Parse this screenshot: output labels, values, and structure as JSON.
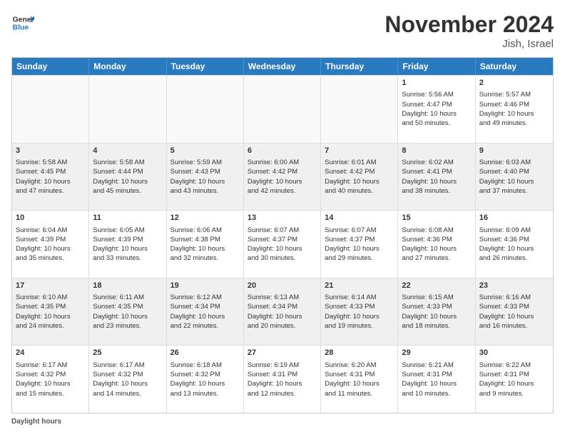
{
  "header": {
    "logo_general": "General",
    "logo_blue": "Blue",
    "title": "November 2024",
    "location": "Jish, Israel"
  },
  "weekdays": [
    "Sunday",
    "Monday",
    "Tuesday",
    "Wednesday",
    "Thursday",
    "Friday",
    "Saturday"
  ],
  "footer_label": "Daylight hours",
  "rows": [
    [
      {
        "day": "",
        "info": ""
      },
      {
        "day": "",
        "info": ""
      },
      {
        "day": "",
        "info": ""
      },
      {
        "day": "",
        "info": ""
      },
      {
        "day": "",
        "info": ""
      },
      {
        "day": "1",
        "info": "Sunrise: 5:56 AM\nSunset: 4:47 PM\nDaylight: 10 hours\nand 50 minutes."
      },
      {
        "day": "2",
        "info": "Sunrise: 5:57 AM\nSunset: 4:46 PM\nDaylight: 10 hours\nand 49 minutes."
      }
    ],
    [
      {
        "day": "3",
        "info": "Sunrise: 5:58 AM\nSunset: 4:45 PM\nDaylight: 10 hours\nand 47 minutes."
      },
      {
        "day": "4",
        "info": "Sunrise: 5:58 AM\nSunset: 4:44 PM\nDaylight: 10 hours\nand 45 minutes."
      },
      {
        "day": "5",
        "info": "Sunrise: 5:59 AM\nSunset: 4:43 PM\nDaylight: 10 hours\nand 43 minutes."
      },
      {
        "day": "6",
        "info": "Sunrise: 6:00 AM\nSunset: 4:42 PM\nDaylight: 10 hours\nand 42 minutes."
      },
      {
        "day": "7",
        "info": "Sunrise: 6:01 AM\nSunset: 4:42 PM\nDaylight: 10 hours\nand 40 minutes."
      },
      {
        "day": "8",
        "info": "Sunrise: 6:02 AM\nSunset: 4:41 PM\nDaylight: 10 hours\nand 38 minutes."
      },
      {
        "day": "9",
        "info": "Sunrise: 6:03 AM\nSunset: 4:40 PM\nDaylight: 10 hours\nand 37 minutes."
      }
    ],
    [
      {
        "day": "10",
        "info": "Sunrise: 6:04 AM\nSunset: 4:39 PM\nDaylight: 10 hours\nand 35 minutes."
      },
      {
        "day": "11",
        "info": "Sunrise: 6:05 AM\nSunset: 4:39 PM\nDaylight: 10 hours\nand 33 minutes."
      },
      {
        "day": "12",
        "info": "Sunrise: 6:06 AM\nSunset: 4:38 PM\nDaylight: 10 hours\nand 32 minutes."
      },
      {
        "day": "13",
        "info": "Sunrise: 6:07 AM\nSunset: 4:37 PM\nDaylight: 10 hours\nand 30 minutes."
      },
      {
        "day": "14",
        "info": "Sunrise: 6:07 AM\nSunset: 4:37 PM\nDaylight: 10 hours\nand 29 minutes."
      },
      {
        "day": "15",
        "info": "Sunrise: 6:08 AM\nSunset: 4:36 PM\nDaylight: 10 hours\nand 27 minutes."
      },
      {
        "day": "16",
        "info": "Sunrise: 6:09 AM\nSunset: 4:36 PM\nDaylight: 10 hours\nand 26 minutes."
      }
    ],
    [
      {
        "day": "17",
        "info": "Sunrise: 6:10 AM\nSunset: 4:35 PM\nDaylight: 10 hours\nand 24 minutes."
      },
      {
        "day": "18",
        "info": "Sunrise: 6:11 AM\nSunset: 4:35 PM\nDaylight: 10 hours\nand 23 minutes."
      },
      {
        "day": "19",
        "info": "Sunrise: 6:12 AM\nSunset: 4:34 PM\nDaylight: 10 hours\nand 22 minutes."
      },
      {
        "day": "20",
        "info": "Sunrise: 6:13 AM\nSunset: 4:34 PM\nDaylight: 10 hours\nand 20 minutes."
      },
      {
        "day": "21",
        "info": "Sunrise: 6:14 AM\nSunset: 4:33 PM\nDaylight: 10 hours\nand 19 minutes."
      },
      {
        "day": "22",
        "info": "Sunrise: 6:15 AM\nSunset: 4:33 PM\nDaylight: 10 hours\nand 18 minutes."
      },
      {
        "day": "23",
        "info": "Sunrise: 6:16 AM\nSunset: 4:33 PM\nDaylight: 10 hours\nand 16 minutes."
      }
    ],
    [
      {
        "day": "24",
        "info": "Sunrise: 6:17 AM\nSunset: 4:32 PM\nDaylight: 10 hours\nand 15 minutes."
      },
      {
        "day": "25",
        "info": "Sunrise: 6:17 AM\nSunset: 4:32 PM\nDaylight: 10 hours\nand 14 minutes."
      },
      {
        "day": "26",
        "info": "Sunrise: 6:18 AM\nSunset: 4:32 PM\nDaylight: 10 hours\nand 13 minutes."
      },
      {
        "day": "27",
        "info": "Sunrise: 6:19 AM\nSunset: 4:31 PM\nDaylight: 10 hours\nand 12 minutes."
      },
      {
        "day": "28",
        "info": "Sunrise: 6:20 AM\nSunset: 4:31 PM\nDaylight: 10 hours\nand 11 minutes."
      },
      {
        "day": "29",
        "info": "Sunrise: 6:21 AM\nSunset: 4:31 PM\nDaylight: 10 hours\nand 10 minutes."
      },
      {
        "day": "30",
        "info": "Sunrise: 6:22 AM\nSunset: 4:31 PM\nDaylight: 10 hours\nand 9 minutes."
      }
    ]
  ]
}
